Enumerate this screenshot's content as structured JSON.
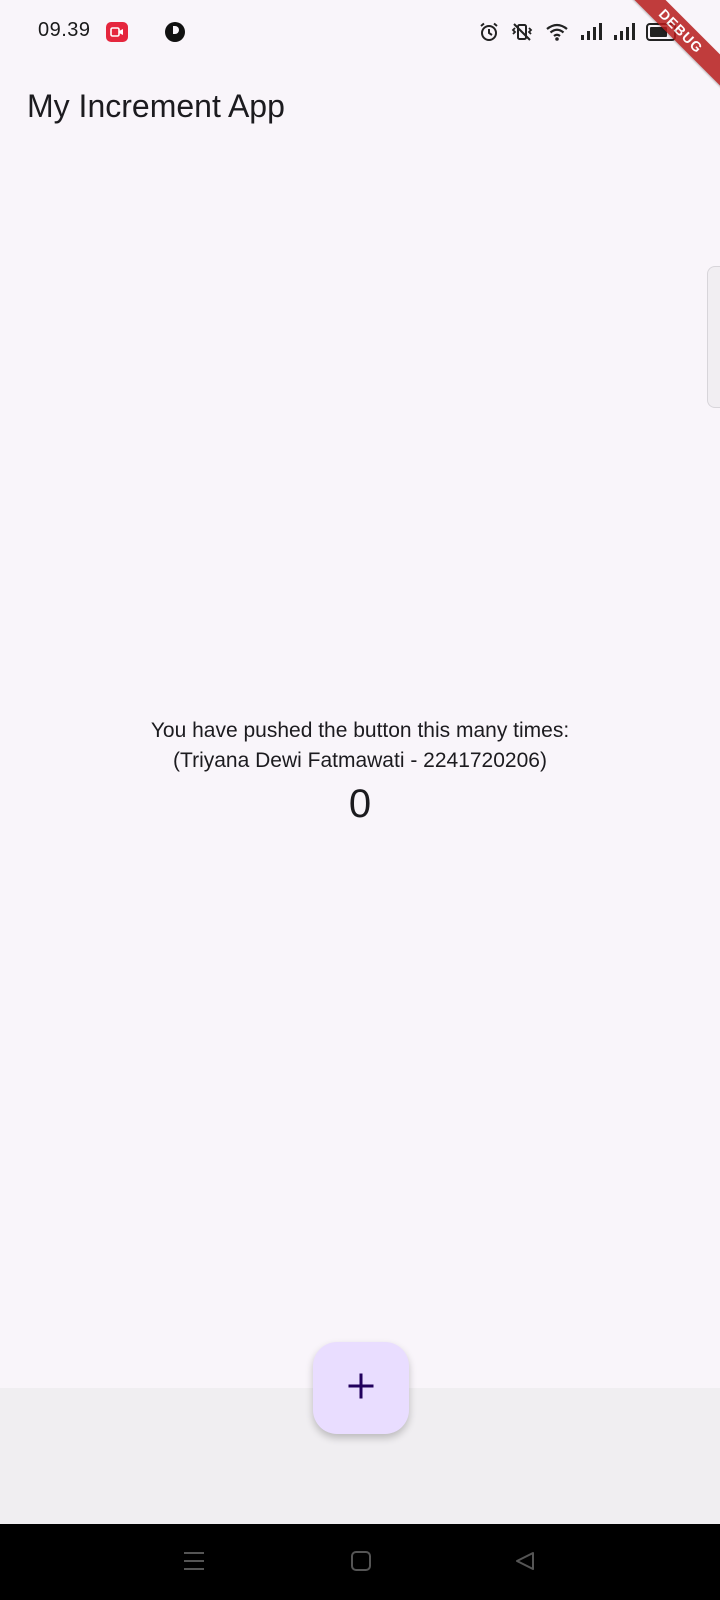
{
  "status_bar": {
    "time": "09.39",
    "icons": [
      "screen-record-icon",
      "app-notification-icon",
      "alarm-icon",
      "vibrate-icon",
      "wifi-icon",
      "signal-icon",
      "signal-icon",
      "battery-icon"
    ]
  },
  "debug_banner": "DEBUG",
  "app_bar": {
    "title": "My Increment App"
  },
  "body": {
    "label_line1": "You have pushed the button this many times:",
    "label_line2": "(Triyana Dewi Fatmawati - 2241720206)",
    "counter": "0"
  },
  "fab": {
    "icon": "plus-icon"
  },
  "navigation": {
    "buttons": [
      "menu-icon",
      "home-icon",
      "back-icon"
    ]
  },
  "colors": {
    "background": "#f9f5fa",
    "fab_background": "#e9ddff",
    "fab_icon": "#21005d",
    "debug_banner": "#b71c1c"
  }
}
